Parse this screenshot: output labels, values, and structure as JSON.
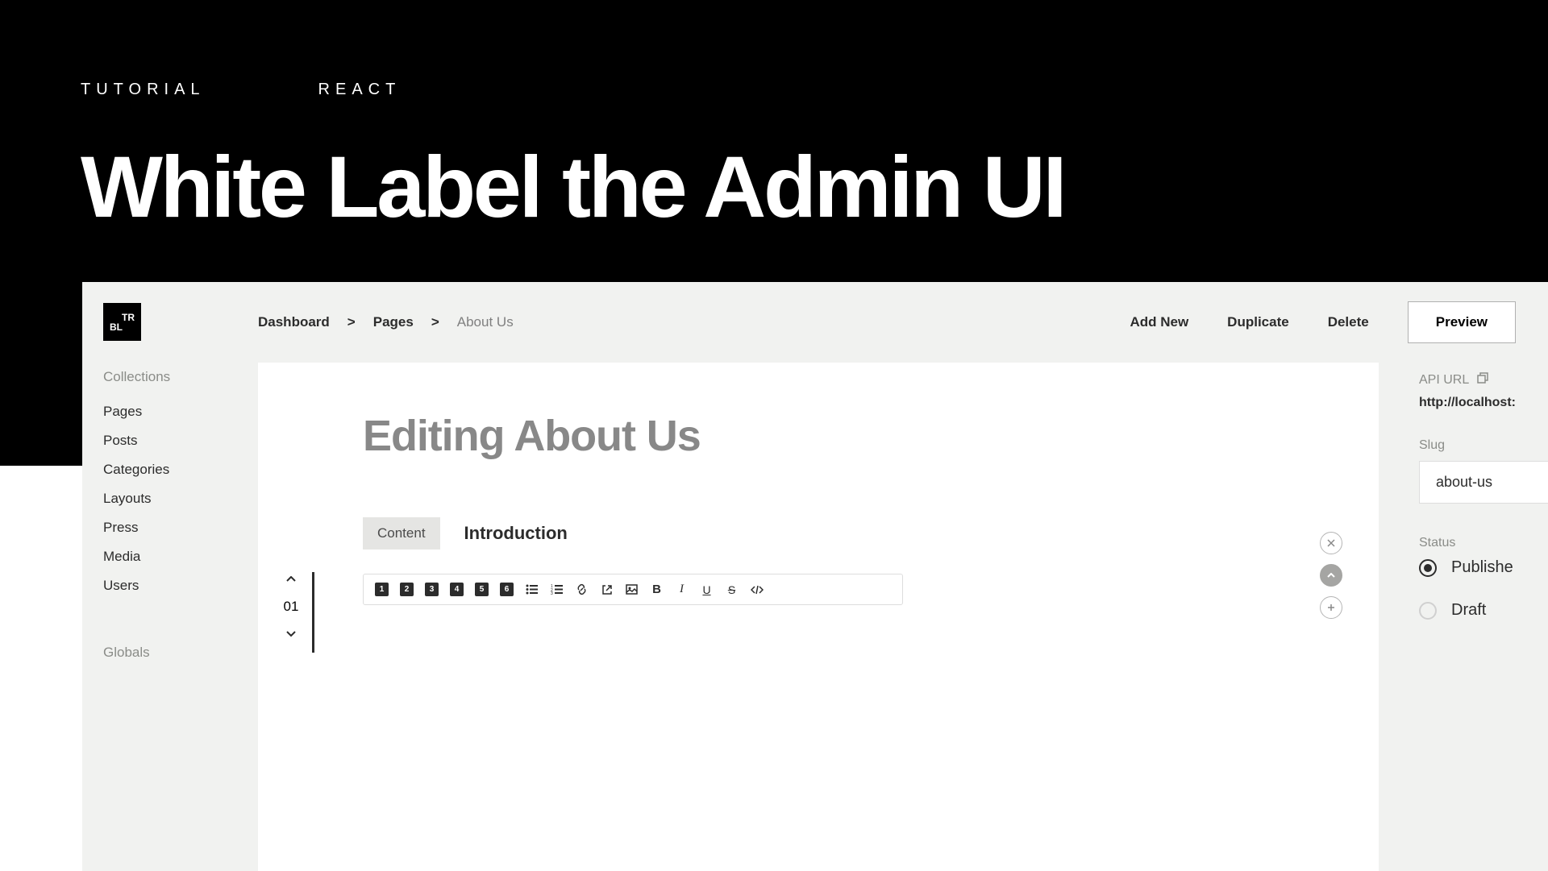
{
  "hero": {
    "tag1": "TUTORIAL",
    "tag2": "REACT",
    "title": "White Label the Admin UI"
  },
  "logo": {
    "line1": "TR",
    "line2": "BL"
  },
  "sidebar": {
    "collections_label": "Collections",
    "items": [
      "Pages",
      "Posts",
      "Categories",
      "Layouts",
      "Press",
      "Media",
      "Users"
    ],
    "globals_label": "Globals"
  },
  "breadcrumb": {
    "items": [
      "Dashboard",
      "Pages",
      "About Us"
    ]
  },
  "actions": {
    "add_new": "Add New",
    "duplicate": "Duplicate",
    "delete": "Delete",
    "preview": "Preview"
  },
  "editor": {
    "title": "Editing About Us",
    "content_tab": "Content",
    "block_label": "Introduction",
    "block_number": "01"
  },
  "toolbar": {
    "headings": [
      "1",
      "2",
      "3",
      "4",
      "5",
      "6"
    ]
  },
  "right": {
    "api_url_label": "API URL",
    "api_url_value": "http://localhost:",
    "slug_label": "Slug",
    "slug_value": "about-us",
    "status_label": "Status",
    "status_published": "Publishe",
    "status_draft": "Draft"
  }
}
